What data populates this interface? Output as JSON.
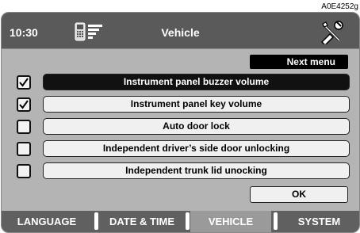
{
  "figure_id": "A0E4252g",
  "header": {
    "time": "10:30",
    "title": "Vehicle"
  },
  "next_menu_label": "Next menu",
  "options": [
    {
      "label": "Instrument panel buzzer volume",
      "checked": true,
      "selected": true
    },
    {
      "label": "Instrument panel key volume",
      "checked": true,
      "selected": false
    },
    {
      "label": "Auto door lock",
      "checked": false,
      "selected": false
    },
    {
      "label": "Independent driver’s side door unlocking",
      "checked": false,
      "selected": false
    },
    {
      "label": "Independent trunk lid unocking",
      "checked": false,
      "selected": false
    }
  ],
  "ok_label": "OK",
  "tabs": [
    {
      "label": "LANGUAGE",
      "active": false
    },
    {
      "label": "DATE & TIME",
      "active": false
    },
    {
      "label": "VEHICLE",
      "active": true
    },
    {
      "label": "SYSTEM",
      "active": false
    }
  ],
  "colors": {
    "screen_bg": "#b4b4b4",
    "topbar": "#5a5a5a",
    "tabbar": "#606060",
    "active_tab": "#9a9a9a"
  }
}
